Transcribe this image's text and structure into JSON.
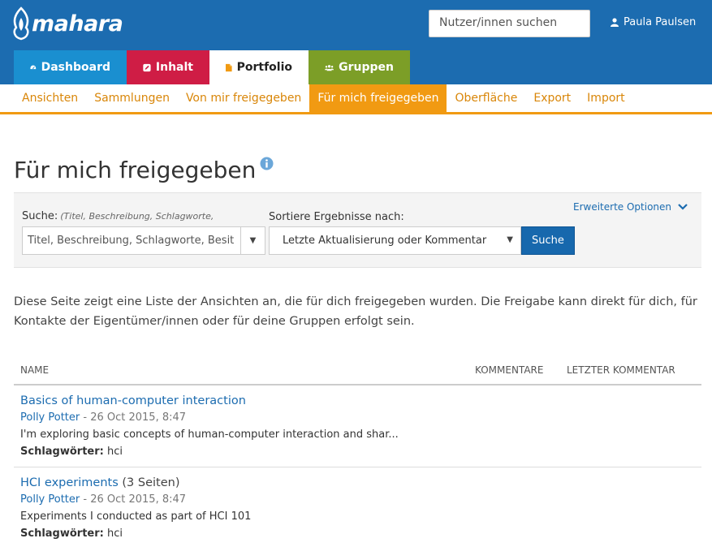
{
  "header": {
    "logo_text": "mahara",
    "search_placeholder": "Nutzer/innen suchen",
    "user_name": "Paula Paulsen"
  },
  "main_tabs": [
    {
      "label": "Dashboard",
      "icon": "tachometer-icon",
      "color": "#1a8fd0"
    },
    {
      "label": "Inhalt",
      "icon": "pencil-square-icon",
      "color": "#cf1d45"
    },
    {
      "label": "Portfolio",
      "icon": "file-icon",
      "color": "#ffffff",
      "active": true
    },
    {
      "label": "Gruppen",
      "icon": "users-icon",
      "color": "#7c9e27"
    }
  ],
  "sub_nav": [
    {
      "label": "Ansichten"
    },
    {
      "label": "Sammlungen"
    },
    {
      "label": "Von mir freigegeben"
    },
    {
      "label": "Für mich freigegeben",
      "active": true
    },
    {
      "label": "Oberfläche"
    },
    {
      "label": "Export"
    },
    {
      "label": "Import"
    }
  ],
  "page": {
    "title": "Für mich freigegeben"
  },
  "search": {
    "advanced_label": "Erweiterte Optionen",
    "query_label": "Suche:",
    "query_hint": "(Titel, Beschreibung, Schlagworte,",
    "query_value": "Titel, Beschreibung, Schlagworte, Besit",
    "sort_label": "Sortiere Ergebnisse nach:",
    "sort_value": "Letzte Aktualisierung oder Kommentar",
    "button_label": "Suche"
  },
  "description": "Diese Seite zeigt eine Liste der Ansichten an, die für dich freigegeben wurden. Die Freigabe kann direkt für dich, für Kontakte der Eigentümer/innen oder für deine Gruppen erfolgt sein.",
  "table": {
    "columns": [
      "Name",
      "Kommentare",
      "Letzter Kommentar"
    ],
    "rows": [
      {
        "title": "Basics of human-computer interaction",
        "pages": "",
        "author": "Polly Potter",
        "date": "- 26 Oct 2015, 8:47",
        "description": "I'm exploring basic concepts of human-computer interaction and shar...",
        "tags_label": "Schlagwörter:",
        "tags": "hci"
      },
      {
        "title": "HCI experiments",
        "pages": "(3 Seiten)",
        "author": "Polly Potter",
        "date": "- 26 Oct 2015, 8:47",
        "description": "Experiments I conducted as part of HCI 101",
        "tags_label": "Schlagwörter:",
        "tags": "hci"
      }
    ]
  },
  "colors": {
    "header_bg": "#1c6cb0",
    "accent_orange": "#f19a12",
    "link_blue": "#1c6cb0",
    "button_blue": "#1768ad"
  }
}
